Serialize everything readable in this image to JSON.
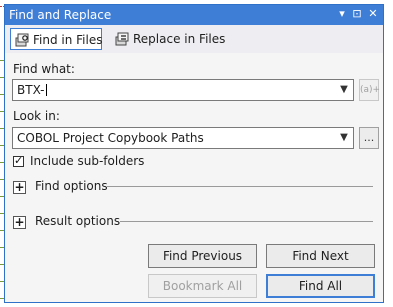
{
  "window": {
    "title": "Find and Replace",
    "title_buttons": [
      "▾",
      "⊡",
      "✕"
    ]
  },
  "tabs": [
    {
      "label": "Find in Files",
      "icon": "find-in-files-icon",
      "active": true
    },
    {
      "label": "Replace in Files",
      "icon": "replace-in-files-icon",
      "active": false
    }
  ],
  "find_what": {
    "label": "Find what:",
    "value": "BTX-",
    "regex_button": "(a)+"
  },
  "look_in": {
    "label": "Look in:",
    "value": "COBOL Project Copybook Paths",
    "browse_button": "..."
  },
  "include_subfolders": {
    "label": "Include sub-folders",
    "checked": true
  },
  "find_options": {
    "label": "Find options",
    "expand_glyph": "+"
  },
  "result_options": {
    "label": "Result options",
    "expand_glyph": "+"
  },
  "buttons": {
    "find_previous": "Find Previous",
    "find_next": "Find Next",
    "bookmark_all": "Bookmark All",
    "find_all": "Find All"
  },
  "colors": {
    "accent": "#3f7ed6",
    "dialog_bg": "#eeeef2"
  }
}
